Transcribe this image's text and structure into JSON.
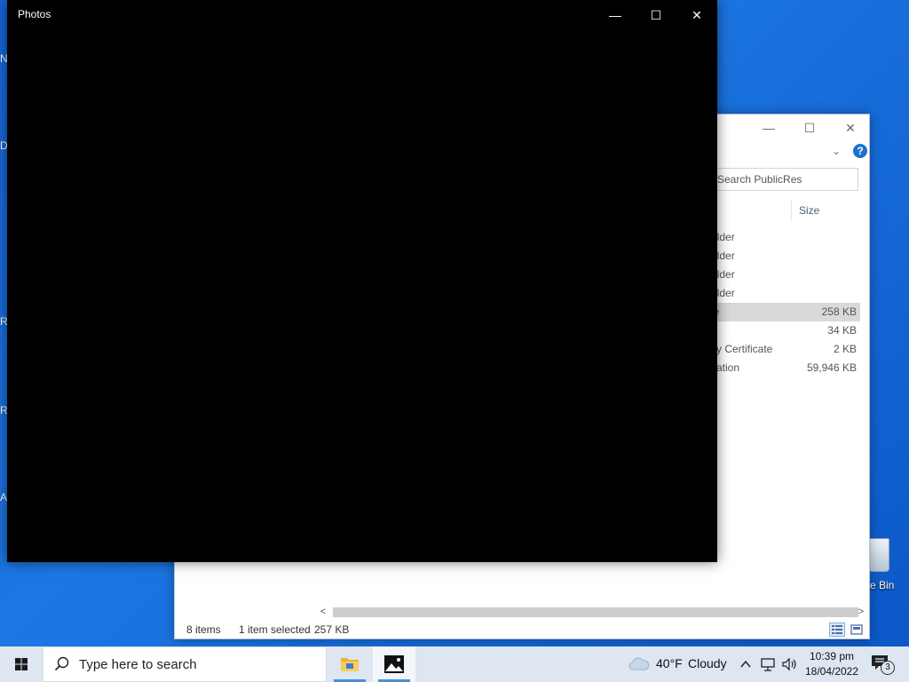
{
  "desktop": {
    "edge_letters": [
      "N",
      "D",
      "R",
      "R",
      "A"
    ],
    "recycle_label": "e Bin"
  },
  "explorer": {
    "controls": {
      "minimize": "—",
      "maximize": "☐",
      "close": "✕"
    },
    "search_placeholder": "Search PublicRes",
    "size_header": "Size",
    "rows": [
      {
        "type": "older",
        "size": ""
      },
      {
        "type": "older",
        "size": ""
      },
      {
        "type": "older",
        "size": ""
      },
      {
        "type": "older",
        "size": ""
      },
      {
        "type": "le",
        "size": "258 KB"
      },
      {
        "type": "",
        "size": "34 KB"
      },
      {
        "type": "ity Certificate",
        "size": "2 KB"
      },
      {
        "type": "cation",
        "size": "59,946 KB"
      }
    ],
    "selected_row": 4,
    "status": {
      "items": "8 items",
      "selected": "1 item selected",
      "selected_size": "257 KB"
    }
  },
  "photos": {
    "title": "Photos",
    "controls": {
      "minimize": "—",
      "maximize": "☐",
      "close": "✕"
    }
  },
  "taskbar": {
    "search_placeholder": "Type here to search",
    "weather": {
      "temp": "40°F",
      "condition": "Cloudy"
    },
    "clock": {
      "time": "10:39 pm",
      "date": "18/04/2022"
    },
    "notification_count": "3"
  },
  "colors": {
    "accent": "#1f6fcf",
    "desktop": "#1d6fe0",
    "taskbar": "#dde6f1"
  }
}
